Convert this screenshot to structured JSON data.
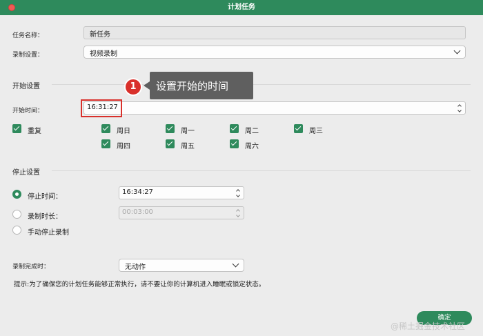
{
  "window": {
    "title": "计划任务"
  },
  "task_name": {
    "label": "任务名称：",
    "value": "新任务"
  },
  "recording_setting": {
    "label": "录制设置：",
    "value": "视频录制"
  },
  "start_section": {
    "title": "开始设置",
    "start_time": {
      "label": "开始时间：",
      "value": "16:31:27"
    },
    "repeat": {
      "label": "重复",
      "checked": true
    },
    "days": [
      {
        "label": "周日",
        "checked": true
      },
      {
        "label": "周一",
        "checked": true
      },
      {
        "label": "周二",
        "checked": true
      },
      {
        "label": "周三",
        "checked": true
      },
      {
        "label": "周四",
        "checked": true
      },
      {
        "label": "周五",
        "checked": true
      },
      {
        "label": "周六",
        "checked": true
      }
    ]
  },
  "stop_section": {
    "title": "停止设置",
    "options": [
      {
        "label": "停止时间：",
        "selected": true,
        "value": "16:34:27"
      },
      {
        "label": "录制时长：",
        "selected": false,
        "value": "00:03:00"
      },
      {
        "label": "手动停止录制",
        "selected": false
      }
    ]
  },
  "on_complete": {
    "label": "录制完成时：",
    "value": "无动作"
  },
  "hint": "提示:为了确保您的计划任务能够正常执行，请不要让你的计算机进入睡眠或锁定状态。",
  "ok_button": "确定",
  "annotation": {
    "number": "1",
    "text": "设置开始的时间"
  },
  "watermark": "@稀土掘金技术社区",
  "colors": {
    "accent": "#2e8a5c",
    "highlight": "#d9302b"
  }
}
